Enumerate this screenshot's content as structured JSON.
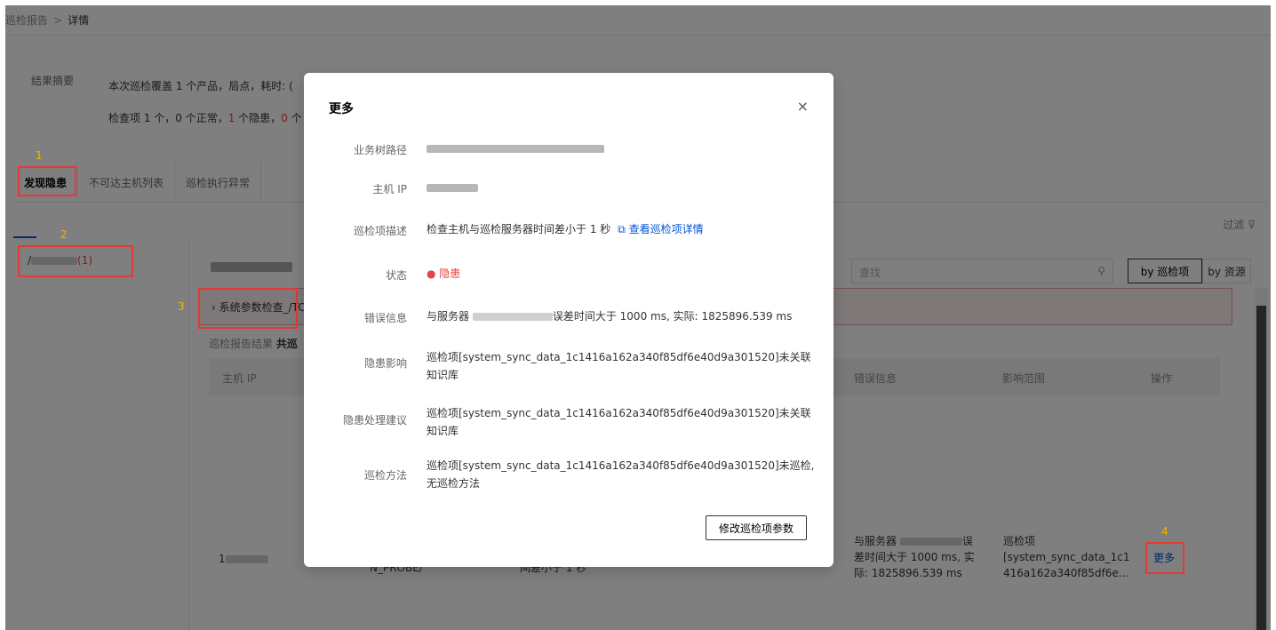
{
  "breadcrumb": {
    "parent": "巡检报告",
    "separator": ">",
    "current": "详情"
  },
  "summary": {
    "label_summary": "结果摘要",
    "line1": "本次巡检覆盖 1 个产品，局点，耗时: (",
    "line2_a": "检查项 1 个，0 个正常，",
    "line2_b": "1",
    "line2_c": " 个隐患，",
    "line2_d": "0",
    "line2_e": " 个"
  },
  "tabs": [
    {
      "label": "发现隐患",
      "active": true
    },
    {
      "label": "不可达主机列表",
      "active": false
    },
    {
      "label": "巡检执行异常",
      "active": false
    }
  ],
  "filter_label": "过滤",
  "tree": {
    "prefix": "/",
    "count": "(1)"
  },
  "search": {
    "placeholder": "查找"
  },
  "view_toggle": {
    "by_item": "by 巡检项",
    "by_resource": "by 资源"
  },
  "alert_row": {
    "text": "› 系统参数检查_/TC"
  },
  "result_line": {
    "label": "巡检报告结果",
    "count_label": "共巡"
  },
  "table": {
    "headers": {
      "host_ip": "主机 IP",
      "error": "错误信息",
      "scope": "影响范围",
      "action": "操作"
    },
    "row": {
      "host_ip_suffix": "1",
      "path_tail": "N_PROBE/",
      "desc_tail": "间差小于 1 秒",
      "error_a": "与服务器",
      "error_b": "误",
      "error_c": "差时间大于 1000 ms, 实",
      "error_d": "际: 1825896.539 ms",
      "scope_a": "巡检项",
      "scope_b": "[system_sync_data_1c1",
      "scope_c": "416a162a340f85df6e...",
      "action": "更多"
    }
  },
  "annotations": {
    "n1": "1",
    "n2": "2",
    "n3": "3",
    "n4": "4"
  },
  "modal": {
    "title": "更多",
    "close": "×",
    "fields": {
      "biz_path_label": "业务树路径",
      "host_ip_label": "主机 IP",
      "desc_label": "巡检项描述",
      "desc_value": "检查主机与巡检服务器时间差小于 1 秒",
      "desc_link": "查看巡检项详情",
      "status_label": "状态",
      "status_value": "● 隐患",
      "error_label": "错误信息",
      "error_a": "与服务器",
      "error_b": "误差时间大于 1000 ms, 实际: 1825896.539 ms",
      "impact_label": "隐患影响",
      "impact_value": "巡检项[system_sync_data_1c1416a162a340f85df6e40d9a301520]未关联知识库",
      "suggestion_label": "隐患处理建议",
      "suggestion_value": "巡检项[system_sync_data_1c1416a162a340f85df6e40d9a301520]未关联知识库",
      "method_label": "巡检方法",
      "method_value": "巡检项[system_sync_data_1c1416a162a340f85df6e40d9a301520]未巡检, 无巡检方法"
    },
    "button": "修改巡检项参数"
  },
  "colors": {
    "accent": "#0052d9",
    "danger": "#e54545",
    "annotation_box": "#e53935",
    "annotation_text": "#f5b400"
  }
}
